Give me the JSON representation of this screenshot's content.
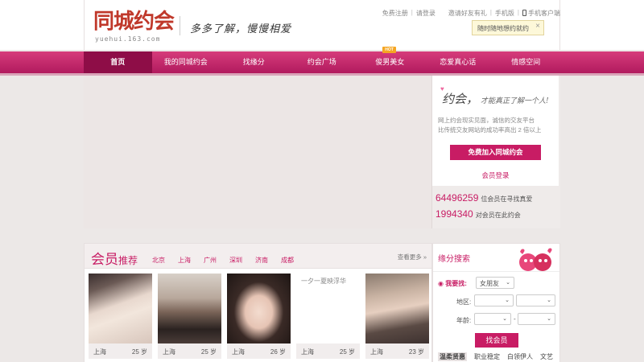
{
  "brand": {
    "logo_text": "同城约会",
    "domain": "yuehui.163.com",
    "slogan": "多多了解，慢慢相爱"
  },
  "toplinks": {
    "register": "免费注册",
    "login": "请登录",
    "invite": "邀请好友有礼",
    "mobile": "手机版",
    "client": "手机客户端",
    "tooltip": "随时随地想约就约",
    "tooltip_close": "×"
  },
  "nav": {
    "items": [
      {
        "label": "首页"
      },
      {
        "label": "我的同城约会"
      },
      {
        "label": "找缘分"
      },
      {
        "label": "约会广场"
      },
      {
        "label": "俊男美女"
      },
      {
        "label": "恋爱真心话"
      },
      {
        "label": "情感空间"
      }
    ],
    "hot_badge": "HOT",
    "active_index": 0
  },
  "hero": {
    "panel": {
      "slogan_main": "约会，",
      "slogan_small": "才能真正了解一个人!",
      "desc_1": "网上约会现实见面，诚信的交友平台",
      "desc_2": "比传统交友网站的成功率高出 2 倍以上",
      "join_button": "免费加入同城约会",
      "login_link": "会员登录"
    },
    "stats": [
      {
        "value": "64496259",
        "label": "位会员在寻找真爱"
      },
      {
        "value": "1994340",
        "label": "对会员在此约会"
      }
    ]
  },
  "members": {
    "title_big": "会员",
    "title_small": "推荐",
    "cities": [
      "北京",
      "上海",
      "广州",
      "深圳",
      "济南",
      "成都"
    ],
    "more": "查看更多 »",
    "cards": [
      {
        "city": "上海",
        "age": "25 岁"
      },
      {
        "city": "上海",
        "age": "25 岁"
      },
      {
        "city": "上海",
        "age": "26 岁"
      },
      {
        "city": "上海",
        "age": "25 岁",
        "text": "一夕一夏映浮华"
      },
      {
        "city": "上海",
        "age": "23 岁"
      }
    ]
  },
  "search": {
    "title": "缘分搜索",
    "seek_label": "我要找:",
    "seek_value": "女朋友",
    "region_label": "地区:",
    "age_label": "年龄:",
    "age_sep": "-",
    "find_button": "找会员",
    "tags": [
      "温柔贤惠",
      "职业稳定",
      "白领伊人",
      "文艺"
    ]
  },
  "colors": {
    "brand": "#c81c64",
    "nav": "#b11a5e"
  }
}
